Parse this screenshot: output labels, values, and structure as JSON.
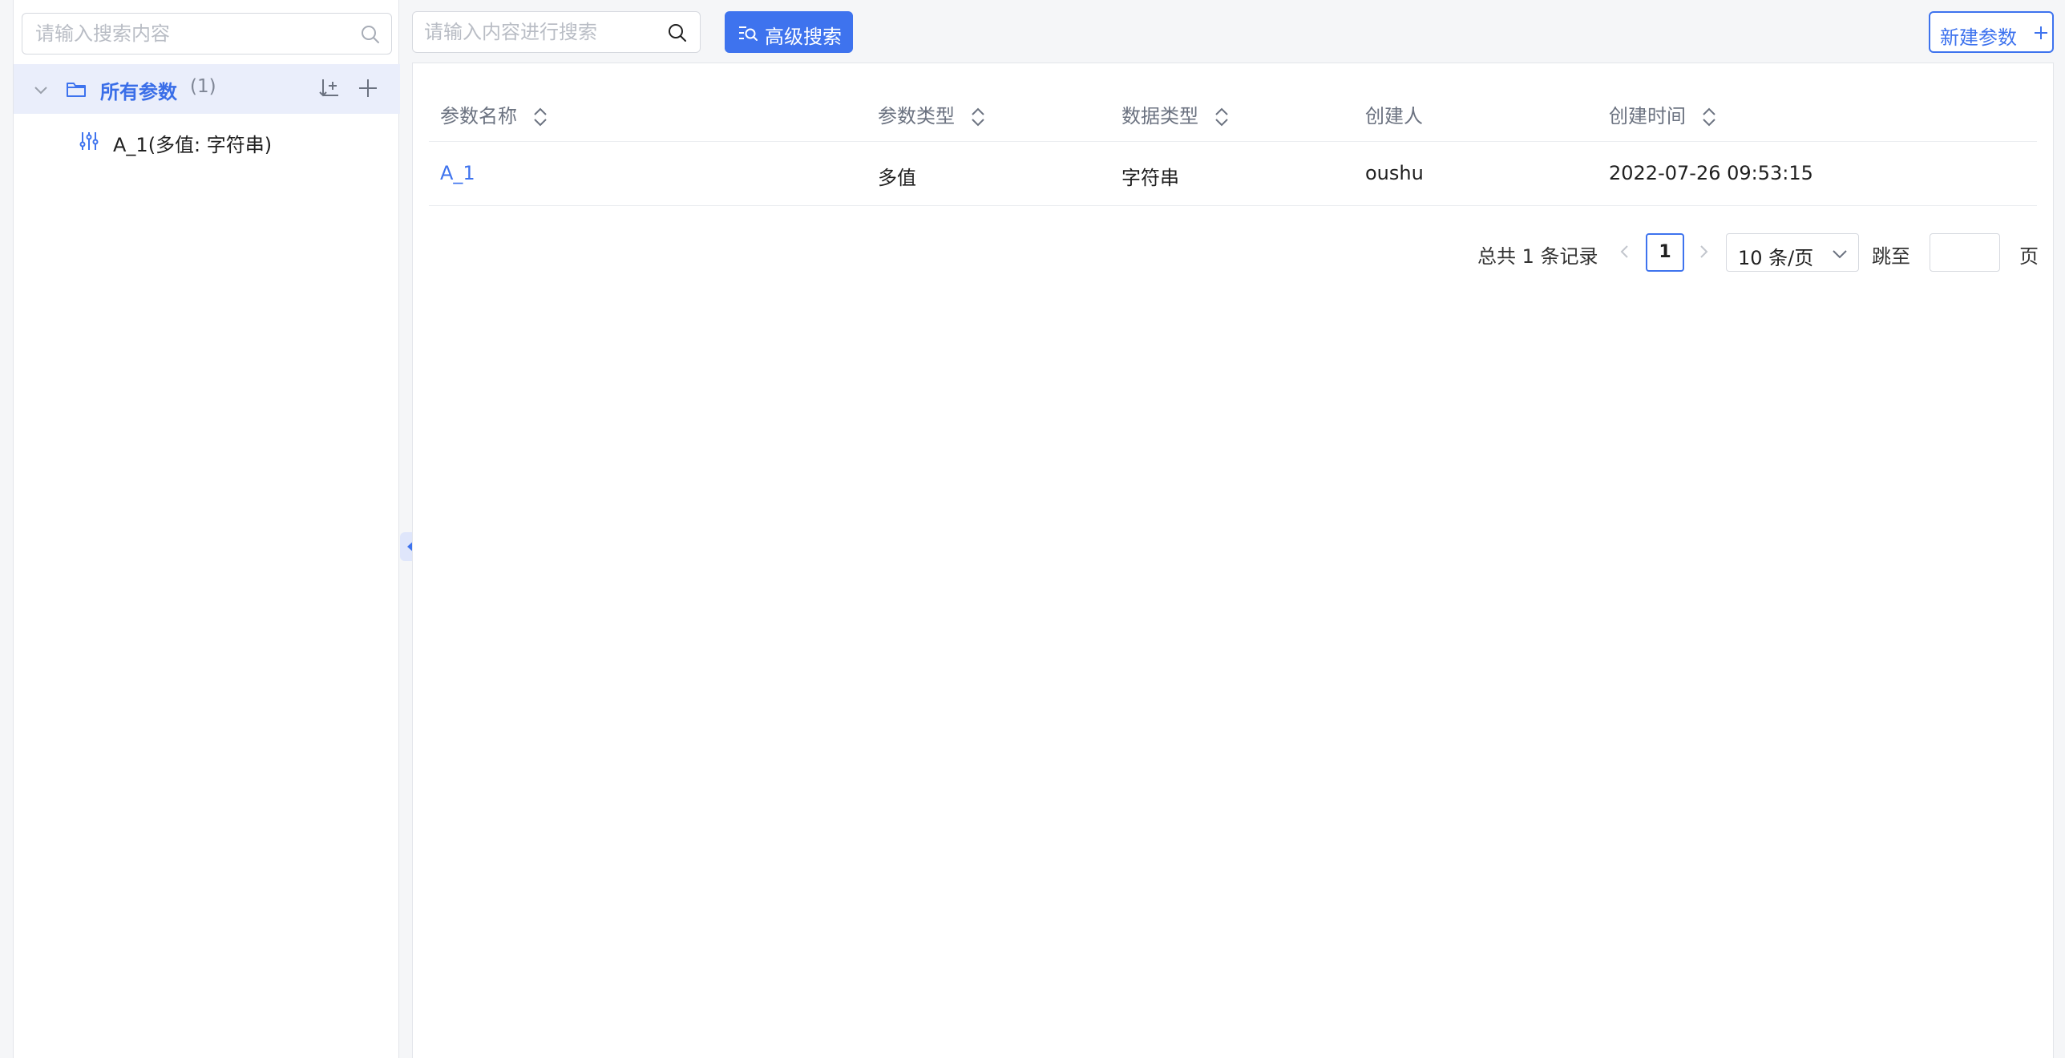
{
  "sidebar": {
    "search_placeholder": "请输入搜索内容",
    "tree": {
      "root_label": "所有参数",
      "root_count": "(1)",
      "children": [
        {
          "label": "A_1(多值: 字符串)"
        }
      ]
    }
  },
  "toolbar": {
    "search_placeholder": "请输入内容进行搜索",
    "advanced_search_label": "高级搜索",
    "new_param_label": "新建参数"
  },
  "table": {
    "columns": [
      "参数名称",
      "参数类型",
      "数据类型",
      "创建人",
      "创建时间"
    ],
    "rows": [
      {
        "name": "A_1",
        "param_type": "多值",
        "data_type": "字符串",
        "creator": "oushu",
        "created_at": "2022-07-26 09:53:15"
      }
    ]
  },
  "pagination": {
    "total_text": "总共 1 条记录",
    "current_page": "1",
    "page_size": "10 条/页",
    "jump_label": "跳至",
    "page_label": "页",
    "jump_value": ""
  },
  "colors": {
    "primary": "#3e73ee",
    "tree_selected_bg": "#eaeefb",
    "background": "#f5f6f8"
  },
  "icons": {
    "side_search": "search-icon",
    "tree_toggle": "chevron-down-icon",
    "tree_folder": "folder-icon",
    "tree_sort": "sort-add-icon",
    "tree_add": "plus-icon",
    "param_item": "sliders-icon",
    "collapse": "caret-left-icon",
    "advanced": "advanced-search-icon",
    "sort": "sort-icon"
  }
}
